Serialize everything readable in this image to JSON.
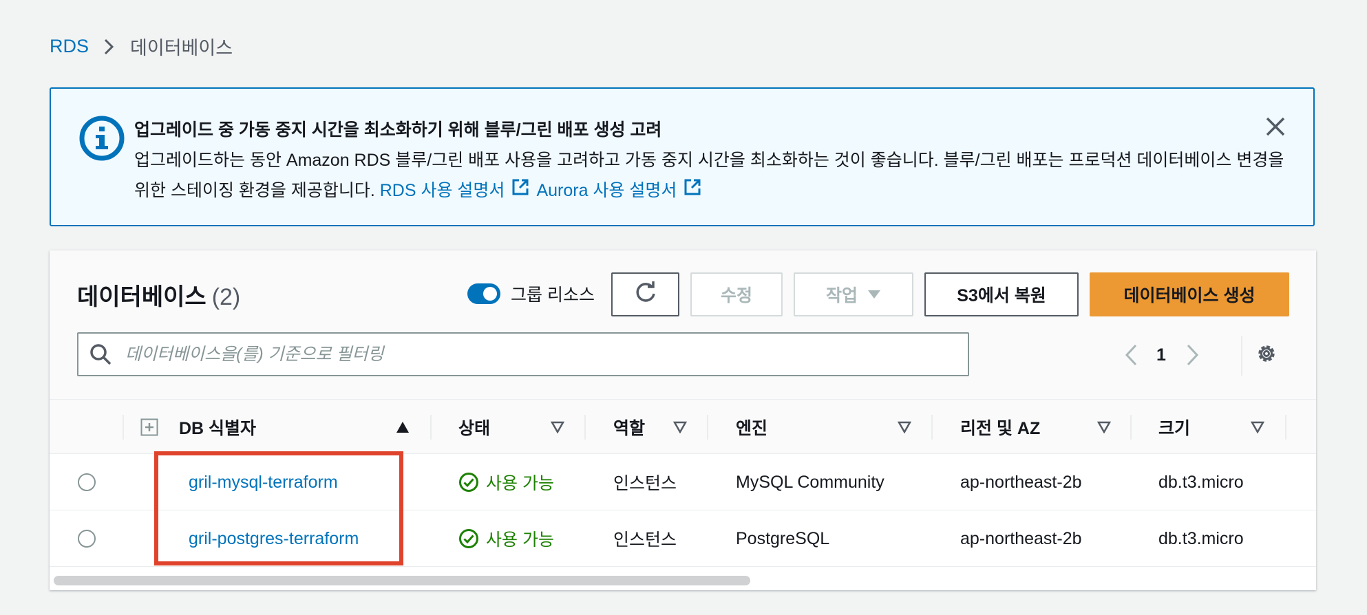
{
  "breadcrumb": {
    "root": "RDS",
    "current": "데이터베이스"
  },
  "alert": {
    "title": "업그레이드 중 가동 중지 시간을 최소화하기 위해 블루/그린 배포 생성 고려",
    "body": "업그레이드하는 동안 Amazon RDS 블루/그린 배포 사용을 고려하고 가동 중지 시간을 최소화하는 것이 좋습니다. 블루/그린 배포는 프로덕션 데이터베이스 변경을 위한 스테이징 환경을 제공합니다.",
    "link_rds": "RDS 사용 설명서",
    "link_aurora": "Aurora 사용 설명서"
  },
  "panel": {
    "title": "데이터베이스",
    "count": "(2)",
    "toggle_label": "그룹 리소스",
    "toggle_on": true,
    "buttons": {
      "edit": "수정",
      "actions": "작업",
      "restore_s3": "S3에서 복원",
      "create": "데이터베이스 생성"
    },
    "search_placeholder": "데이터베이스을(를) 기준으로 필터링",
    "page": "1"
  },
  "table": {
    "columns": {
      "identifier": "DB 식별자",
      "status": "상태",
      "role": "역할",
      "engine": "엔진",
      "region": "리전 및 AZ",
      "size": "크기"
    },
    "rows": [
      {
        "identifier": "gril-mysql-terraform",
        "status": "사용 가능",
        "role": "인스턴스",
        "engine": "MySQL Community",
        "region": "ap-northeast-2b",
        "size": "db.t3.micro"
      },
      {
        "identifier": "gril-postgres-terraform",
        "status": "사용 가능",
        "role": "인스턴스",
        "engine": "PostgreSQL",
        "region": "ap-northeast-2b",
        "size": "db.t3.micro"
      }
    ]
  },
  "colors": {
    "link": "#0073bb",
    "primary_button": "#ec9933",
    "status_available": "#1d8102",
    "highlight_box": "#e0432c"
  },
  "icons": [
    "chevron-right-icon",
    "info-icon",
    "close-icon",
    "external-link-icon",
    "refresh-icon",
    "caret-down-icon",
    "search-icon",
    "chevron-left-icon",
    "gear-icon",
    "expand-icon",
    "sort-ascending-icon",
    "sort-icon",
    "check-circle-icon"
  ]
}
